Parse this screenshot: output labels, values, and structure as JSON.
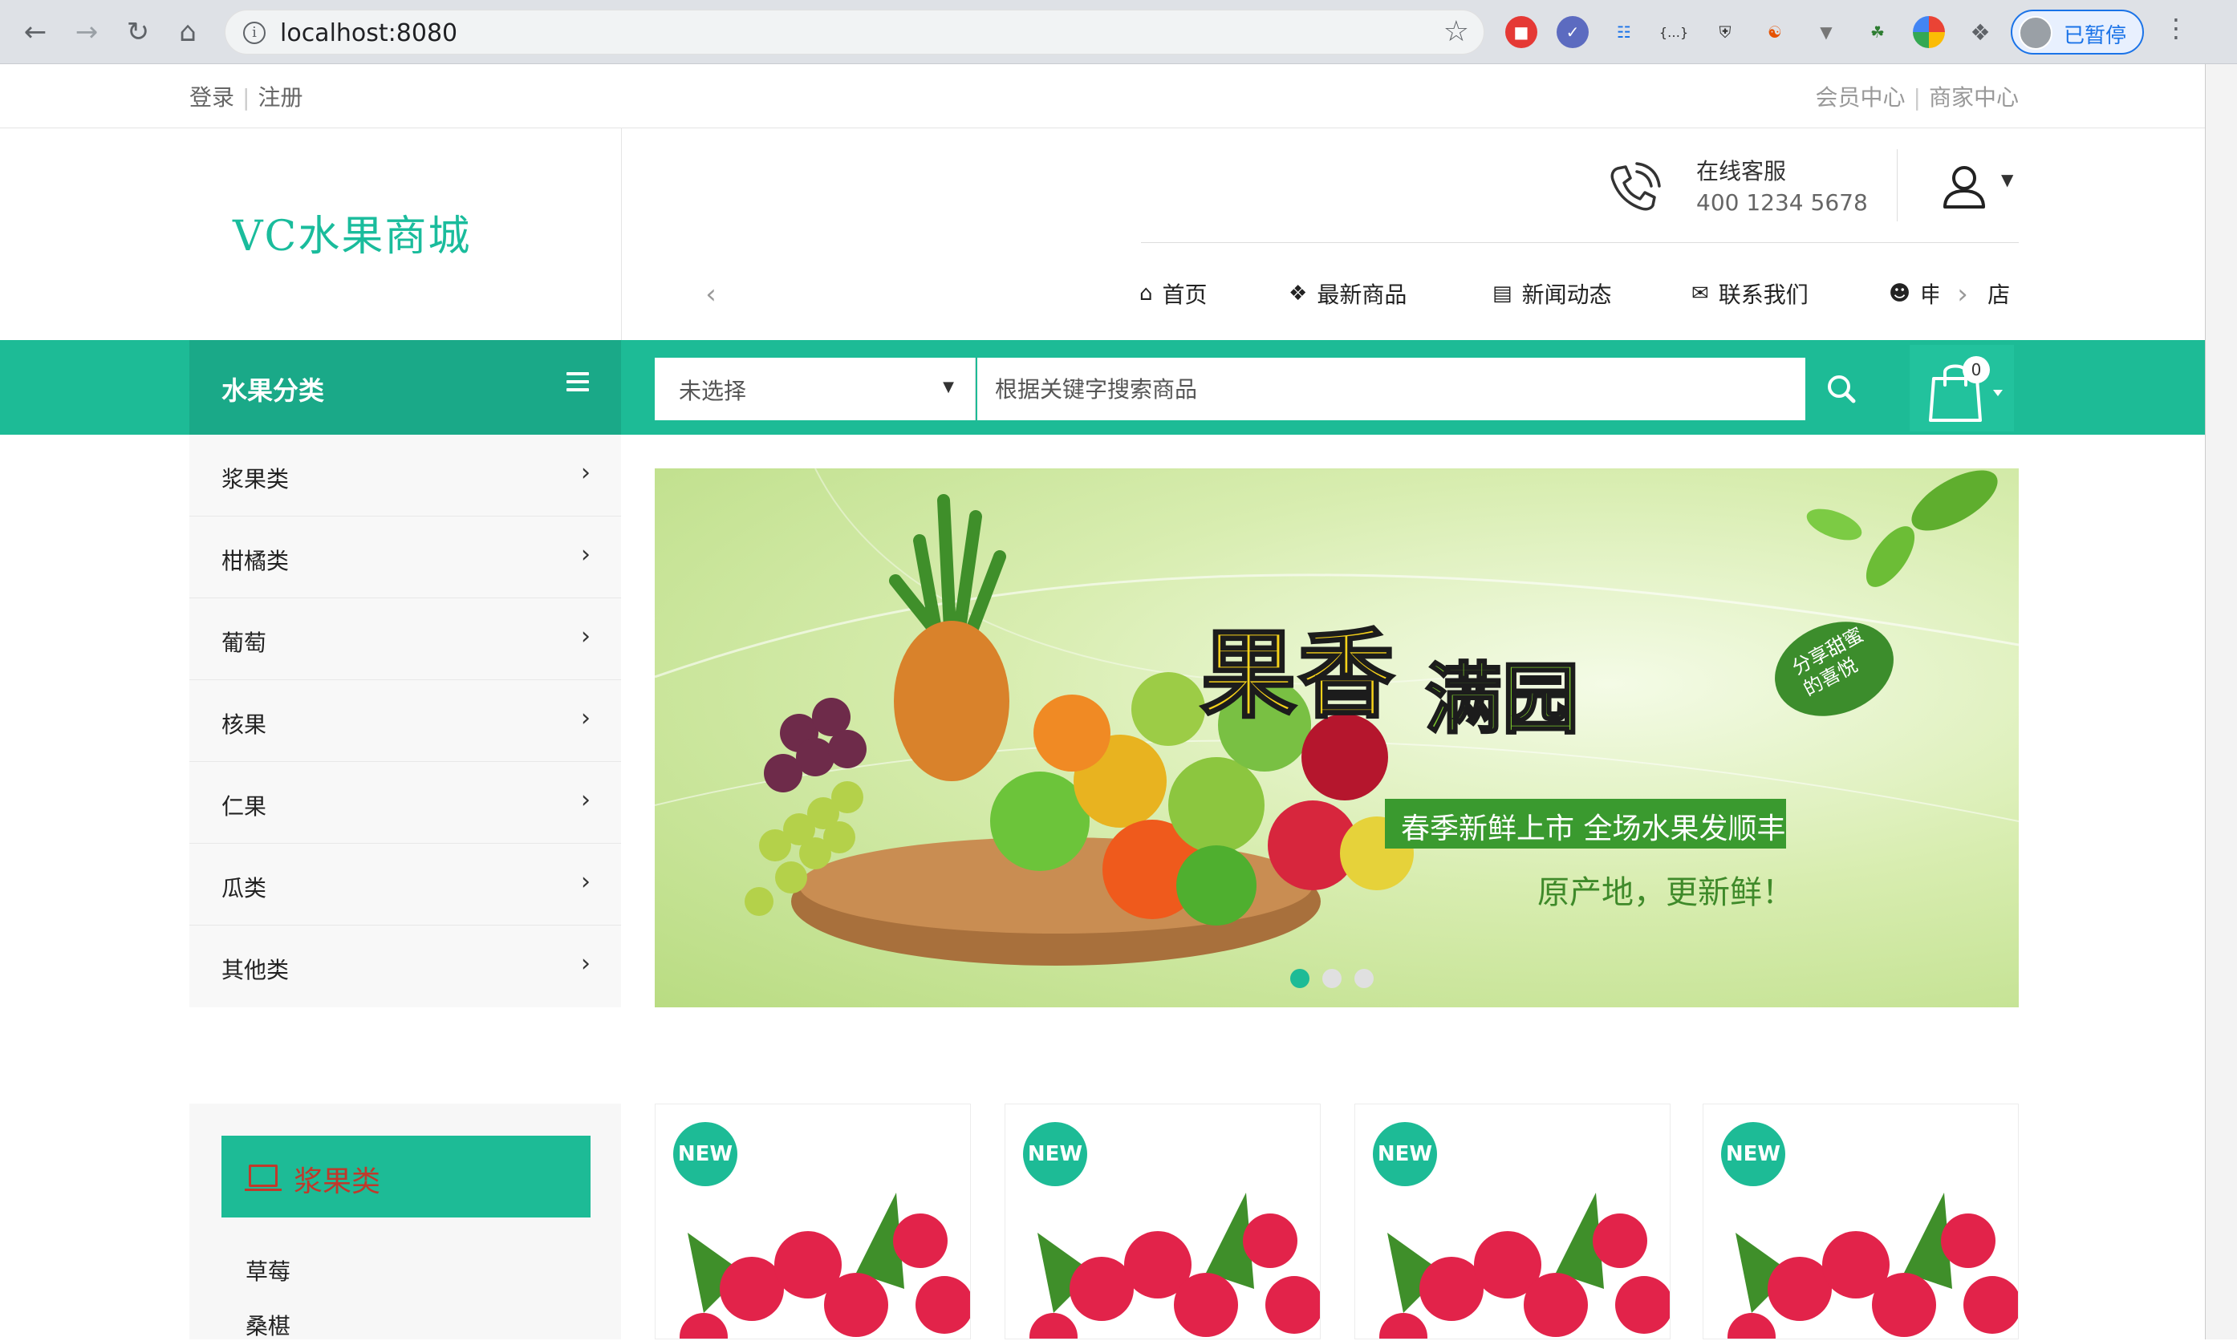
{
  "browser": {
    "url": "localhost:8080",
    "profile_label": "已暂停"
  },
  "topbar": {
    "login": "登录",
    "register": "注册",
    "member_center": "会员中心",
    "merchant_center": "商家中心"
  },
  "header": {
    "logo_text": "VC水果商城",
    "service_title": "在线客服",
    "service_phone": "400 1234 5678"
  },
  "nav": [
    {
      "label": "首页",
      "icon": "home-icon"
    },
    {
      "label": "最新商品",
      "icon": "cubes-icon"
    },
    {
      "label": "新闻动态",
      "icon": "newspaper-icon"
    },
    {
      "label": "联系我们",
      "icon": "envelope-icon"
    },
    {
      "label": "申请开店",
      "icon": "user-plus-icon"
    }
  ],
  "category_header": "水果分类",
  "search": {
    "select_value": "未选择",
    "placeholder": "根据关键字搜索商品"
  },
  "cart": {
    "count": "0"
  },
  "categories": [
    "浆果类",
    "柑橘类",
    "葡萄",
    "核果",
    "仁果",
    "瓜类",
    "其他类"
  ],
  "banner": {
    "title_part1": "果香",
    "title_part2": "满园",
    "leaf_text": "分享甜蜜的喜悦",
    "subtitle": "春季新鲜上市 全场水果发顺丰",
    "tagline": "原产地，更新鲜！",
    "slides": 3,
    "active_slide": 1
  },
  "section": {
    "title": "浆果类",
    "items": [
      "草莓",
      "桑椹"
    ]
  },
  "products": [
    {
      "badge": "NEW"
    },
    {
      "badge": "NEW"
    },
    {
      "badge": "NEW"
    },
    {
      "badge": "NEW"
    }
  ],
  "colors": {
    "accent": "#1dbb96",
    "accent_dark": "#1aa988",
    "section_title": "#c0392b"
  }
}
